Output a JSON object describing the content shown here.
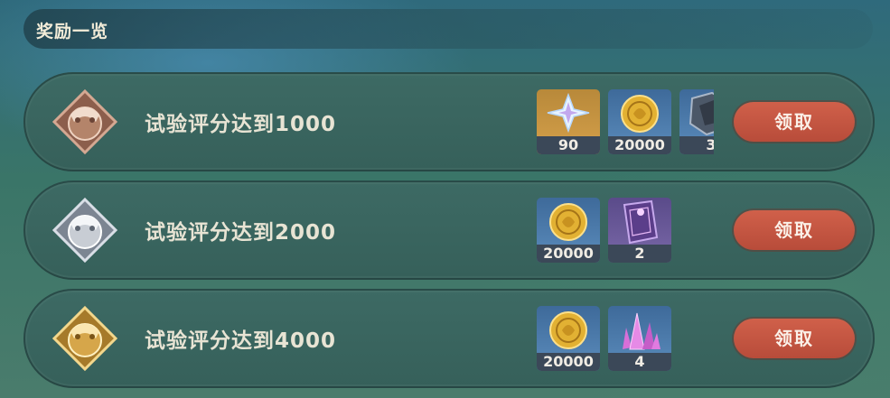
{
  "header": {
    "title": "奖励一览"
  },
  "rows": [
    {
      "label": "试验评分达到1000",
      "medal": "bronze-medal-icon",
      "claim_label": "领取",
      "items": [
        {
          "icon": "primogem-icon",
          "count": "90"
        },
        {
          "icon": "mora-coin-icon",
          "count": "20000"
        },
        {
          "icon": "material-icon",
          "count": "3"
        }
      ]
    },
    {
      "label": "试验评分达到2000",
      "medal": "silver-medal-icon",
      "claim_label": "领取",
      "items": [
        {
          "icon": "mora-coin-icon",
          "count": "20000"
        },
        {
          "icon": "book-icon",
          "count": "2"
        }
      ]
    },
    {
      "label": "试验评分达到4000",
      "medal": "gold-medal-icon",
      "claim_label": "领取",
      "items": [
        {
          "icon": "mora-coin-icon",
          "count": "20000"
        },
        {
          "icon": "crystal-icon",
          "count": "4"
        }
      ]
    }
  ],
  "colors": {
    "claim_button": "#c4563f",
    "row_bg": "#3a665f",
    "count_bar": "#3b4858",
    "bronze": "#b4846a",
    "silver": "#c8cdd4",
    "gold": "#d6a64a"
  }
}
